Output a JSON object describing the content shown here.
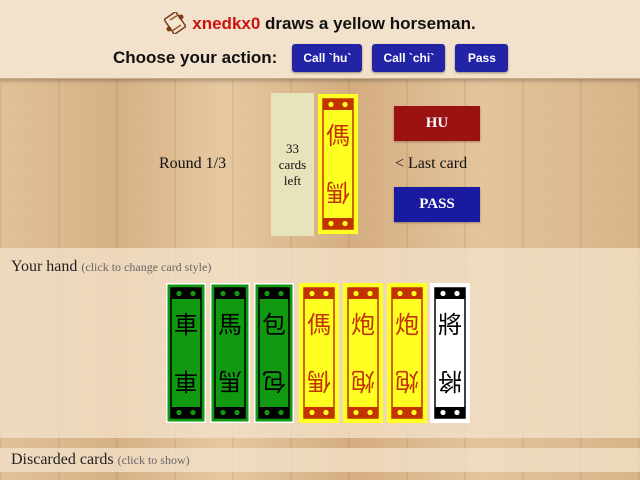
{
  "header": {
    "player_name": "xnedkx0",
    "status_rest": " draws a yellow horseman.",
    "action_label": "Choose your action:",
    "buttons": [
      "Call `hu`",
      "Call `chi`",
      "Pass"
    ]
  },
  "table": {
    "round": "Round 1/3",
    "deck": {
      "count": "33",
      "line2": "cards",
      "line3": "left"
    },
    "last_card_label": "< Last card",
    "last_card": {
      "color": "yellow",
      "top": "傌",
      "bottom": "傌"
    },
    "hu_button": "HU",
    "pass_button": "PASS"
  },
  "hand": {
    "title": "Your hand",
    "hint": "(click to change card style)",
    "cards": [
      {
        "color": "green",
        "top": "車",
        "bottom": "車"
      },
      {
        "color": "green",
        "top": "馬",
        "bottom": "馬"
      },
      {
        "color": "green",
        "top": "包",
        "bottom": "包"
      },
      {
        "color": "yellow",
        "top": "傌",
        "bottom": "傌"
      },
      {
        "color": "yellow",
        "top": "炮",
        "bottom": "炮"
      },
      {
        "color": "yellow",
        "top": "炮",
        "bottom": "炮"
      },
      {
        "color": "white",
        "top": "將",
        "bottom": "將"
      }
    ]
  },
  "discard": {
    "title": "Discarded cards",
    "hint": "(click to show)"
  },
  "colors": {
    "green": "#119911",
    "yellow": "#ffff22",
    "white": "#ffffff",
    "red_button": "#9a1212",
    "blue_button": "#1a1aa0"
  }
}
